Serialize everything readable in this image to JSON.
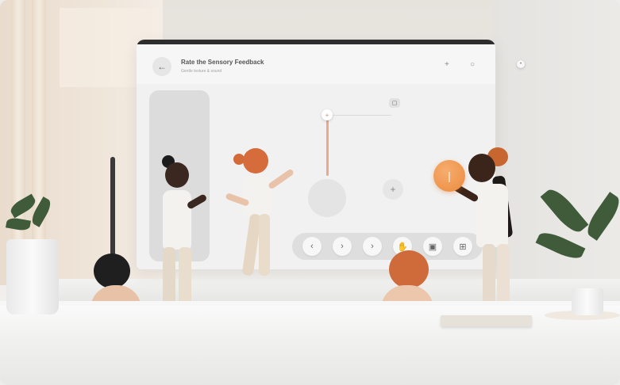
{
  "panel": {
    "title": "Rate the Sensory Feedback",
    "subtitle": "Gentle texture & sound",
    "back_icon": "arrow-left-icon",
    "header_icons": [
      "plus-icon",
      "circle-icon"
    ]
  },
  "controls": {
    "slider_icon": "plus-icon",
    "chip_icon": "square-icon",
    "mid_button_icon": "plus-icon",
    "orange_button_icon": "line-icon",
    "floating_icon": "dot-icon"
  },
  "toolbar": {
    "buttons": [
      {
        "icon": "chevron-left-icon",
        "glyph": "‹"
      },
      {
        "icon": "chevron-right-icon",
        "glyph": "›"
      },
      {
        "icon": "chevron-right-icon",
        "glyph": "›"
      },
      {
        "icon": "hand-icon",
        "glyph": "✋"
      },
      {
        "icon": "bookmark-icon",
        "glyph": "▣"
      },
      {
        "icon": "grid-icon",
        "glyph": "⊞"
      }
    ]
  },
  "colors": {
    "accent_orange": "#ea8a3f",
    "slider": "#e9a98c",
    "panel_bg": "#f1f1f1"
  }
}
